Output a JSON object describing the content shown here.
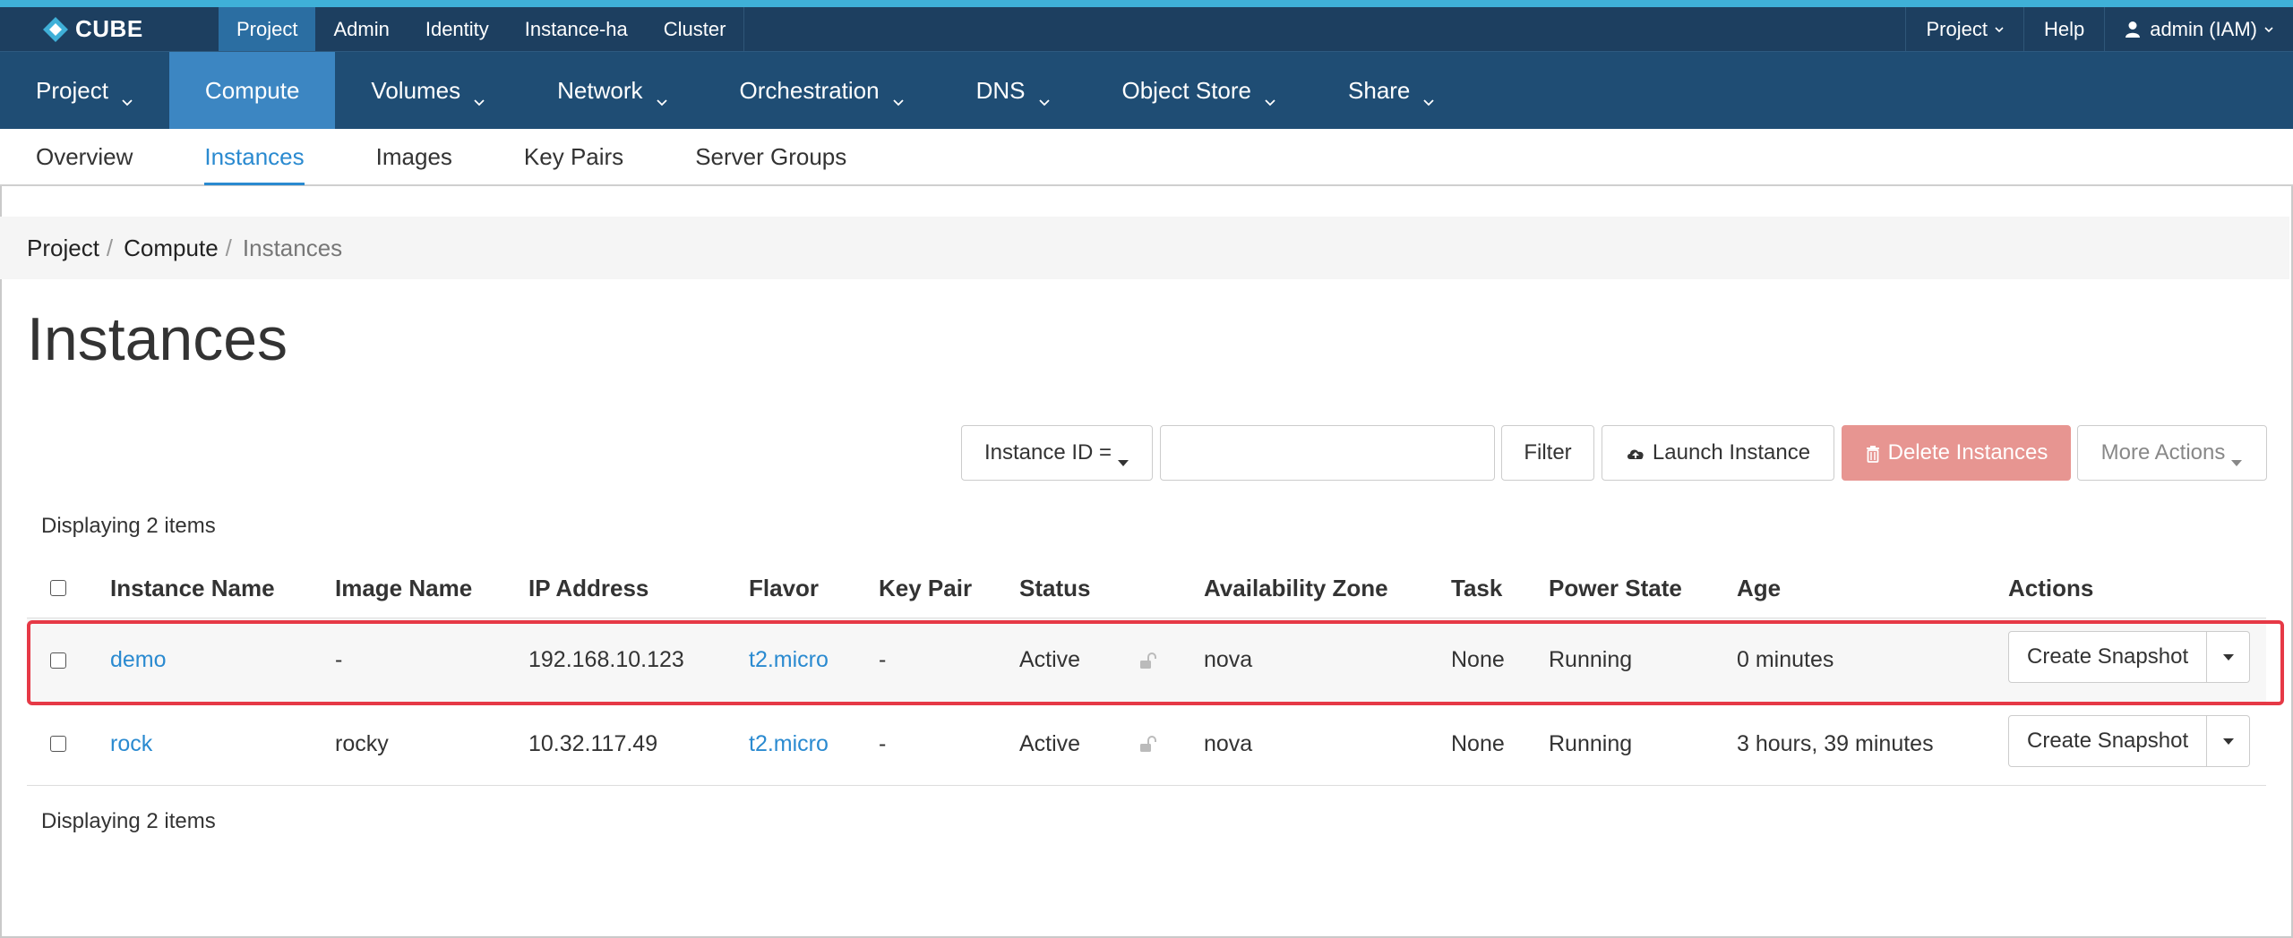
{
  "brand": {
    "name": "CUBE"
  },
  "topnav": {
    "items": [
      {
        "label": "Project",
        "active": true
      },
      {
        "label": "Admin"
      },
      {
        "label": "Identity"
      },
      {
        "label": "Instance-ha"
      },
      {
        "label": "Cluster"
      }
    ],
    "right": {
      "project_label": "Project",
      "help_label": "Help",
      "user_label": "admin (IAM)"
    }
  },
  "mainnav": {
    "items": [
      {
        "label": "Project"
      },
      {
        "label": "Compute"
      },
      {
        "label": "Volumes"
      },
      {
        "label": "Network"
      },
      {
        "label": "Orchestration"
      },
      {
        "label": "DNS"
      },
      {
        "label": "Object Store"
      },
      {
        "label": "Share"
      }
    ]
  },
  "subnav": {
    "items": [
      {
        "label": "Overview"
      },
      {
        "label": "Instances"
      },
      {
        "label": "Images"
      },
      {
        "label": "Key Pairs"
      },
      {
        "label": "Server Groups"
      }
    ]
  },
  "breadcrumb": {
    "project": "Project",
    "compute": "Compute",
    "current": "Instances",
    "separator": "/"
  },
  "page": {
    "title": "Instances"
  },
  "toolbar": {
    "filter_select_label": "Instance ID =",
    "filter_input_value": "",
    "filter_button": "Filter",
    "launch_button": "Launch Instance",
    "delete_button": "Delete Instances",
    "more_actions": "More Actions"
  },
  "table": {
    "count_text": "Displaying 2 items",
    "columns": {
      "instance_name": "Instance Name",
      "image_name": "Image Name",
      "ip_address": "IP Address",
      "flavor": "Flavor",
      "key_pair": "Key Pair",
      "status": "Status",
      "availability_zone": "Availability Zone",
      "task": "Task",
      "power_state": "Power State",
      "age": "Age",
      "actions": "Actions"
    },
    "rows": [
      {
        "name": "demo",
        "image": "-",
        "ip": "192.168.10.123",
        "flavor": "t2.micro",
        "key_pair": "-",
        "status": "Active",
        "zone": "nova",
        "task": "None",
        "power": "Running",
        "age": "0 minutes",
        "action": "Create Snapshot"
      },
      {
        "name": "rock",
        "image": "rocky",
        "ip": "10.32.117.49",
        "flavor": "t2.micro",
        "key_pair": "-",
        "status": "Active",
        "zone": "nova",
        "task": "None",
        "power": "Running",
        "age": "3 hours, 39 minutes",
        "action": "Create Snapshot"
      }
    ]
  },
  "colors": {
    "topbar": "#1d3f60",
    "mainnav": "#1f4d74",
    "active_tab": "#3c86c2",
    "link": "#2a8ad0",
    "danger": "#e79591",
    "highlight": "#e63946"
  }
}
